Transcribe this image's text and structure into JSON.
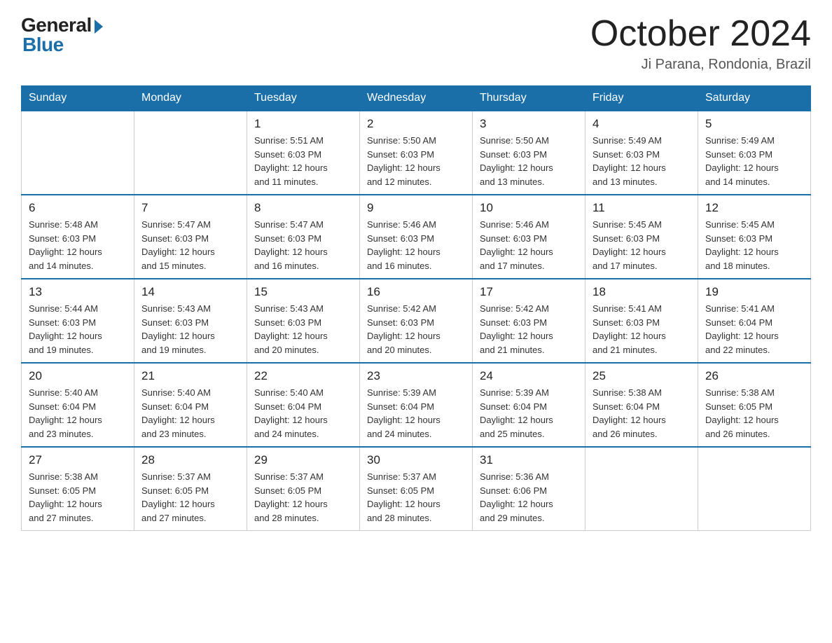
{
  "logo": {
    "general": "General",
    "blue": "Blue"
  },
  "title": "October 2024",
  "subtitle": "Ji Parana, Rondonia, Brazil",
  "days_header": [
    "Sunday",
    "Monday",
    "Tuesday",
    "Wednesday",
    "Thursday",
    "Friday",
    "Saturday"
  ],
  "weeks": [
    [
      {
        "day": "",
        "info": ""
      },
      {
        "day": "",
        "info": ""
      },
      {
        "day": "1",
        "info": "Sunrise: 5:51 AM\nSunset: 6:03 PM\nDaylight: 12 hours\nand 11 minutes."
      },
      {
        "day": "2",
        "info": "Sunrise: 5:50 AM\nSunset: 6:03 PM\nDaylight: 12 hours\nand 12 minutes."
      },
      {
        "day": "3",
        "info": "Sunrise: 5:50 AM\nSunset: 6:03 PM\nDaylight: 12 hours\nand 13 minutes."
      },
      {
        "day": "4",
        "info": "Sunrise: 5:49 AM\nSunset: 6:03 PM\nDaylight: 12 hours\nand 13 minutes."
      },
      {
        "day": "5",
        "info": "Sunrise: 5:49 AM\nSunset: 6:03 PM\nDaylight: 12 hours\nand 14 minutes."
      }
    ],
    [
      {
        "day": "6",
        "info": "Sunrise: 5:48 AM\nSunset: 6:03 PM\nDaylight: 12 hours\nand 14 minutes."
      },
      {
        "day": "7",
        "info": "Sunrise: 5:47 AM\nSunset: 6:03 PM\nDaylight: 12 hours\nand 15 minutes."
      },
      {
        "day": "8",
        "info": "Sunrise: 5:47 AM\nSunset: 6:03 PM\nDaylight: 12 hours\nand 16 minutes."
      },
      {
        "day": "9",
        "info": "Sunrise: 5:46 AM\nSunset: 6:03 PM\nDaylight: 12 hours\nand 16 minutes."
      },
      {
        "day": "10",
        "info": "Sunrise: 5:46 AM\nSunset: 6:03 PM\nDaylight: 12 hours\nand 17 minutes."
      },
      {
        "day": "11",
        "info": "Sunrise: 5:45 AM\nSunset: 6:03 PM\nDaylight: 12 hours\nand 17 minutes."
      },
      {
        "day": "12",
        "info": "Sunrise: 5:45 AM\nSunset: 6:03 PM\nDaylight: 12 hours\nand 18 minutes."
      }
    ],
    [
      {
        "day": "13",
        "info": "Sunrise: 5:44 AM\nSunset: 6:03 PM\nDaylight: 12 hours\nand 19 minutes."
      },
      {
        "day": "14",
        "info": "Sunrise: 5:43 AM\nSunset: 6:03 PM\nDaylight: 12 hours\nand 19 minutes."
      },
      {
        "day": "15",
        "info": "Sunrise: 5:43 AM\nSunset: 6:03 PM\nDaylight: 12 hours\nand 20 minutes."
      },
      {
        "day": "16",
        "info": "Sunrise: 5:42 AM\nSunset: 6:03 PM\nDaylight: 12 hours\nand 20 minutes."
      },
      {
        "day": "17",
        "info": "Sunrise: 5:42 AM\nSunset: 6:03 PM\nDaylight: 12 hours\nand 21 minutes."
      },
      {
        "day": "18",
        "info": "Sunrise: 5:41 AM\nSunset: 6:03 PM\nDaylight: 12 hours\nand 21 minutes."
      },
      {
        "day": "19",
        "info": "Sunrise: 5:41 AM\nSunset: 6:04 PM\nDaylight: 12 hours\nand 22 minutes."
      }
    ],
    [
      {
        "day": "20",
        "info": "Sunrise: 5:40 AM\nSunset: 6:04 PM\nDaylight: 12 hours\nand 23 minutes."
      },
      {
        "day": "21",
        "info": "Sunrise: 5:40 AM\nSunset: 6:04 PM\nDaylight: 12 hours\nand 23 minutes."
      },
      {
        "day": "22",
        "info": "Sunrise: 5:40 AM\nSunset: 6:04 PM\nDaylight: 12 hours\nand 24 minutes."
      },
      {
        "day": "23",
        "info": "Sunrise: 5:39 AM\nSunset: 6:04 PM\nDaylight: 12 hours\nand 24 minutes."
      },
      {
        "day": "24",
        "info": "Sunrise: 5:39 AM\nSunset: 6:04 PM\nDaylight: 12 hours\nand 25 minutes."
      },
      {
        "day": "25",
        "info": "Sunrise: 5:38 AM\nSunset: 6:04 PM\nDaylight: 12 hours\nand 26 minutes."
      },
      {
        "day": "26",
        "info": "Sunrise: 5:38 AM\nSunset: 6:05 PM\nDaylight: 12 hours\nand 26 minutes."
      }
    ],
    [
      {
        "day": "27",
        "info": "Sunrise: 5:38 AM\nSunset: 6:05 PM\nDaylight: 12 hours\nand 27 minutes."
      },
      {
        "day": "28",
        "info": "Sunrise: 5:37 AM\nSunset: 6:05 PM\nDaylight: 12 hours\nand 27 minutes."
      },
      {
        "day": "29",
        "info": "Sunrise: 5:37 AM\nSunset: 6:05 PM\nDaylight: 12 hours\nand 28 minutes."
      },
      {
        "day": "30",
        "info": "Sunrise: 5:37 AM\nSunset: 6:05 PM\nDaylight: 12 hours\nand 28 minutes."
      },
      {
        "day": "31",
        "info": "Sunrise: 5:36 AM\nSunset: 6:06 PM\nDaylight: 12 hours\nand 29 minutes."
      },
      {
        "day": "",
        "info": ""
      },
      {
        "day": "",
        "info": ""
      }
    ]
  ]
}
